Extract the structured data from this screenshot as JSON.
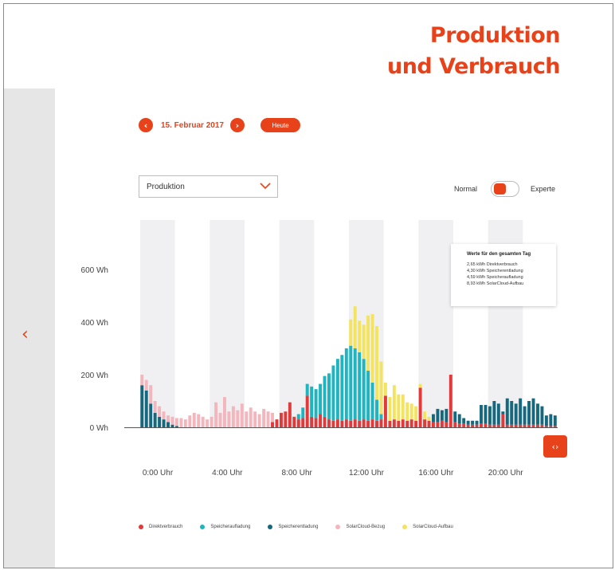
{
  "header": {
    "title_line1": "Produktion",
    "title_line2": "und Verbrauch"
  },
  "date_nav": {
    "prev_icon": "chevron-left-icon",
    "date": "15. Februar 2017",
    "next_icon": "chevron-right-icon",
    "today_label": "Heute"
  },
  "view_select": {
    "value": "Produktion",
    "icon": "chevron-down-icon"
  },
  "mode_toggle": {
    "left_label": "Normal",
    "right_label": "Experte",
    "state": "Normal"
  },
  "tooltip": {
    "title": "Werte für den gesamten Tag",
    "lines": [
      "2,65 kWh Direktverbrauch",
      "4,30 kWh Speicherentladung",
      "4,59 kWh Speicheraufladung",
      "8,93 kWh SolarCloud-Aufbau"
    ]
  },
  "colors": {
    "accent": "#e8421a",
    "direkt": "#e03a3a",
    "aufladung": "#1eb4c0",
    "entladung": "#16687f",
    "bezug": "#f3b6bd",
    "aufbau": "#f3e35f"
  },
  "chart_data": {
    "type": "bar",
    "stacked": true,
    "interval_minutes": 15,
    "ylabel_ticks": [
      "600 Wh",
      "400 Wh",
      "200 Wh",
      "0 Wh"
    ],
    "y_tick_values": [
      600,
      400,
      200,
      0
    ],
    "ylim": [
      0,
      650
    ],
    "xlim_hours": [
      0,
      24
    ],
    "x_tick_labels": [
      "0:00 Uhr",
      "4:00 Uhr",
      "8:00 Uhr",
      "12:00 Uhr",
      "16:00 Uhr",
      "20:00 Uhr"
    ],
    "x_tick_hours": [
      0,
      4,
      8,
      12,
      16,
      20
    ],
    "shaded_bands_hours": [
      [
        0,
        2
      ],
      [
        4,
        6
      ],
      [
        8,
        10
      ],
      [
        12,
        14
      ],
      [
        16,
        18
      ],
      [
        20,
        22
      ]
    ],
    "series": [
      {
        "name": "Direktverbrauch",
        "color": "#e03a3a"
      },
      {
        "name": "Speicheraufladung",
        "color": "#1eb4c0"
      },
      {
        "name": "Speicherentladung",
        "color": "#16687f"
      },
      {
        "name": "SolarCloud-Bezug",
        "color": "#f3b6bd"
      },
      {
        "name": "SolarCloud-Aufbau",
        "color": "#f3e35f"
      }
    ],
    "legend_position": "bottom",
    "bars": [
      {
        "t": 0.0,
        "speicherentladung": 160,
        "solarcloud_bezug": 40
      },
      {
        "t": 0.25,
        "speicherentladung": 140,
        "solarcloud_bezug": 40
      },
      {
        "t": 0.5,
        "speicherentladung": 90,
        "solarcloud_bezug": 70
      },
      {
        "t": 0.75,
        "speicherentladung": 55,
        "solarcloud_bezug": 45
      },
      {
        "t": 1.0,
        "speicherentladung": 40,
        "solarcloud_bezug": 40
      },
      {
        "t": 1.25,
        "speicherentladung": 30,
        "solarcloud_bezug": 30
      },
      {
        "t": 1.5,
        "speicherentladung": 20,
        "solarcloud_bezug": 25
      },
      {
        "t": 1.75,
        "speicherentladung": 10,
        "solarcloud_bezug": 30
      },
      {
        "t": 2.0,
        "speicherentladung": 5,
        "solarcloud_bezug": 30
      },
      {
        "t": 2.25,
        "solarcloud_bezug": 35
      },
      {
        "t": 2.5,
        "solarcloud_bezug": 30
      },
      {
        "t": 2.75,
        "solarcloud_bezug": 45
      },
      {
        "t": 3.0,
        "solarcloud_bezug": 55
      },
      {
        "t": 3.25,
        "solarcloud_bezug": 50
      },
      {
        "t": 3.5,
        "solarcloud_bezug": 40
      },
      {
        "t": 3.75,
        "solarcloud_bezug": 30
      },
      {
        "t": 4.0,
        "solarcloud_bezug": 40
      },
      {
        "t": 4.25,
        "solarcloud_bezug": 95
      },
      {
        "t": 4.5,
        "solarcloud_bezug": 55
      },
      {
        "t": 4.75,
        "solarcloud_bezug": 115
      },
      {
        "t": 5.0,
        "solarcloud_bezug": 60
      },
      {
        "t": 5.25,
        "solarcloud_bezug": 80
      },
      {
        "t": 5.5,
        "solarcloud_bezug": 65
      },
      {
        "t": 5.75,
        "solarcloud_bezug": 90
      },
      {
        "t": 6.0,
        "solarcloud_bezug": 60
      },
      {
        "t": 6.25,
        "solarcloud_bezug": 75
      },
      {
        "t": 6.5,
        "solarcloud_bezug": 60
      },
      {
        "t": 6.75,
        "solarcloud_bezug": 50
      },
      {
        "t": 7.0,
        "solarcloud_bezug": 70
      },
      {
        "t": 7.25,
        "solarcloud_bezug": 60
      },
      {
        "t": 7.5,
        "direktverbrauch": 20,
        "solarcloud_bezug": 35
      },
      {
        "t": 7.75,
        "direktverbrauch": 30
      },
      {
        "t": 8.0,
        "direktverbrauch": 55
      },
      {
        "t": 8.25,
        "direktverbrauch": 60
      },
      {
        "t": 8.5,
        "direktverbrauch": 95
      },
      {
        "t": 8.75,
        "direktverbrauch": 40
      },
      {
        "t": 9.0,
        "direktverbrauch": 30,
        "speicheraufladung": 20
      },
      {
        "t": 9.25,
        "direktverbrauch": 35,
        "speicheraufladung": 40
      },
      {
        "t": 9.5,
        "direktverbrauch": 120,
        "speicheraufladung": 45
      },
      {
        "t": 9.75,
        "direktverbrauch": 40,
        "speicheraufladung": 115
      },
      {
        "t": 10.0,
        "direktverbrauch": 35,
        "speicheraufladung": 110
      },
      {
        "t": 10.25,
        "direktverbrauch": 50,
        "speicheraufladung": 115
      },
      {
        "t": 10.5,
        "direktverbrauch": 40,
        "speicheraufladung": 155
      },
      {
        "t": 10.75,
        "direktverbrauch": 30,
        "speicheraufladung": 175
      },
      {
        "t": 11.0,
        "direktverbrauch": 25,
        "speicheraufladung": 210
      },
      {
        "t": 11.25,
        "direktverbrauch": 30,
        "speicheraufladung": 230
      },
      {
        "t": 11.5,
        "direktverbrauch": 25,
        "speicheraufladung": 250
      },
      {
        "t": 11.75,
        "direktverbrauch": 30,
        "speicheraufladung": 270
      },
      {
        "t": 12.0,
        "direktverbrauch": 25,
        "speicheraufladung": 285,
        "solarcloud_aufbau": 100
      },
      {
        "t": 12.25,
        "direktverbrauch": 30,
        "speicheraufladung": 270,
        "solarcloud_aufbau": 160
      },
      {
        "t": 12.5,
        "direktverbrauch": 25,
        "speicheraufladung": 260,
        "solarcloud_aufbau": 120
      },
      {
        "t": 12.75,
        "direktverbrauch": 30,
        "speicheraufladung": 230,
        "solarcloud_aufbau": 130
      },
      {
        "t": 13.0,
        "direktverbrauch": 25,
        "speicheraufladung": 190,
        "solarcloud_aufbau": 210
      },
      {
        "t": 13.25,
        "direktverbrauch": 30,
        "speicheraufladung": 140,
        "solarcloud_aufbau": 260
      },
      {
        "t": 13.5,
        "direktverbrauch": 25,
        "speicheraufladung": 80,
        "solarcloud_aufbau": 280
      },
      {
        "t": 13.75,
        "direktverbrauch": 30,
        "speicheraufladung": 20,
        "solarcloud_aufbau": 200
      },
      {
        "t": 14.0,
        "direktverbrauch": 120,
        "solarcloud_aufbau": 50
      },
      {
        "t": 14.25,
        "direktverbrauch": 25,
        "solarcloud_aufbau": 90
      },
      {
        "t": 14.5,
        "direktverbrauch": 30,
        "solarcloud_aufbau": 130
      },
      {
        "t": 14.75,
        "direktverbrauch": 25,
        "solarcloud_aufbau": 100
      },
      {
        "t": 15.0,
        "direktverbrauch": 30,
        "solarcloud_aufbau": 95
      },
      {
        "t": 15.25,
        "direktverbrauch": 25,
        "solarcloud_aufbau": 70
      },
      {
        "t": 15.5,
        "direktverbrauch": 30,
        "solarcloud_aufbau": 60
      },
      {
        "t": 15.75,
        "direktverbrauch": 25,
        "solarcloud_aufbau": 55
      },
      {
        "t": 16.0,
        "direktverbrauch": 150,
        "solarcloud_aufbau": 15
      },
      {
        "t": 16.25,
        "direktverbrauch": 30,
        "solarcloud_aufbau": 30
      },
      {
        "t": 16.5,
        "direktverbrauch": 25,
        "solarcloud_aufbau": 15
      },
      {
        "t": 16.75,
        "direktverbrauch": 20,
        "speicherentladung": 30
      },
      {
        "t": 17.0,
        "direktverbrauch": 20,
        "speicherentladung": 50
      },
      {
        "t": 17.25,
        "direktverbrauch": 25,
        "speicherentladung": 40
      },
      {
        "t": 17.5,
        "direktverbrauch": 20,
        "speicherentladung": 50
      },
      {
        "t": 17.75,
        "direktverbrauch": 200,
        "speicherentladung": 0
      },
      {
        "t": 18.0,
        "direktverbrauch": 20,
        "speicherentladung": 40
      },
      {
        "t": 18.25,
        "direktverbrauch": 15,
        "speicherentladung": 35
      },
      {
        "t": 18.5,
        "direktverbrauch": 15,
        "speicherentladung": 20
      },
      {
        "t": 18.75,
        "direktverbrauch": 10,
        "speicherentladung": 15
      },
      {
        "t": 19.0,
        "direktverbrauch": 10,
        "speicherentladung": 15
      },
      {
        "t": 19.25,
        "direktverbrauch": 10,
        "speicherentladung": 15
      },
      {
        "t": 19.5,
        "direktverbrauch": 15,
        "speicherentladung": 70
      },
      {
        "t": 19.75,
        "direktverbrauch": 15,
        "speicherentladung": 70
      },
      {
        "t": 20.0,
        "direktverbrauch": 10,
        "speicherentladung": 70
      },
      {
        "t": 20.25,
        "direktverbrauch": 10,
        "speicherentladung": 90
      },
      {
        "t": 20.5,
        "direktverbrauch": 10,
        "speicherentladung": 80
      },
      {
        "t": 20.75,
        "direktverbrauch": 50,
        "speicherentladung": 10
      },
      {
        "t": 21.0,
        "direktverbrauch": 10,
        "speicherentladung": 100
      },
      {
        "t": 21.25,
        "direktverbrauch": 10,
        "speicherentladung": 90
      },
      {
        "t": 21.5,
        "direktverbrauch": 10,
        "speicherentladung": 80
      },
      {
        "t": 21.75,
        "direktverbrauch": 10,
        "speicherentladung": 100
      },
      {
        "t": 22.0,
        "direktverbrauch": 10,
        "speicherentladung": 70
      },
      {
        "t": 22.25,
        "direktverbrauch": 10,
        "speicherentladung": 90
      },
      {
        "t": 22.5,
        "direktverbrauch": 10,
        "speicherentladung": 100
      },
      {
        "t": 22.75,
        "direktverbrauch": 10,
        "speicherentladung": 80
      },
      {
        "t": 23.0,
        "direktverbrauch": 10,
        "speicherentladung": 70
      },
      {
        "t": 23.25,
        "direktverbrauch": 5,
        "speicherentladung": 40
      },
      {
        "t": 23.5,
        "direktverbrauch": 5,
        "speicherentladung": 45
      },
      {
        "t": 23.75,
        "direktverbrauch": 5,
        "speicherentladung": 40
      }
    ]
  },
  "icons": {
    "side_prev": "chevron-left-icon",
    "scroll": "scroll-arrows-icon"
  }
}
